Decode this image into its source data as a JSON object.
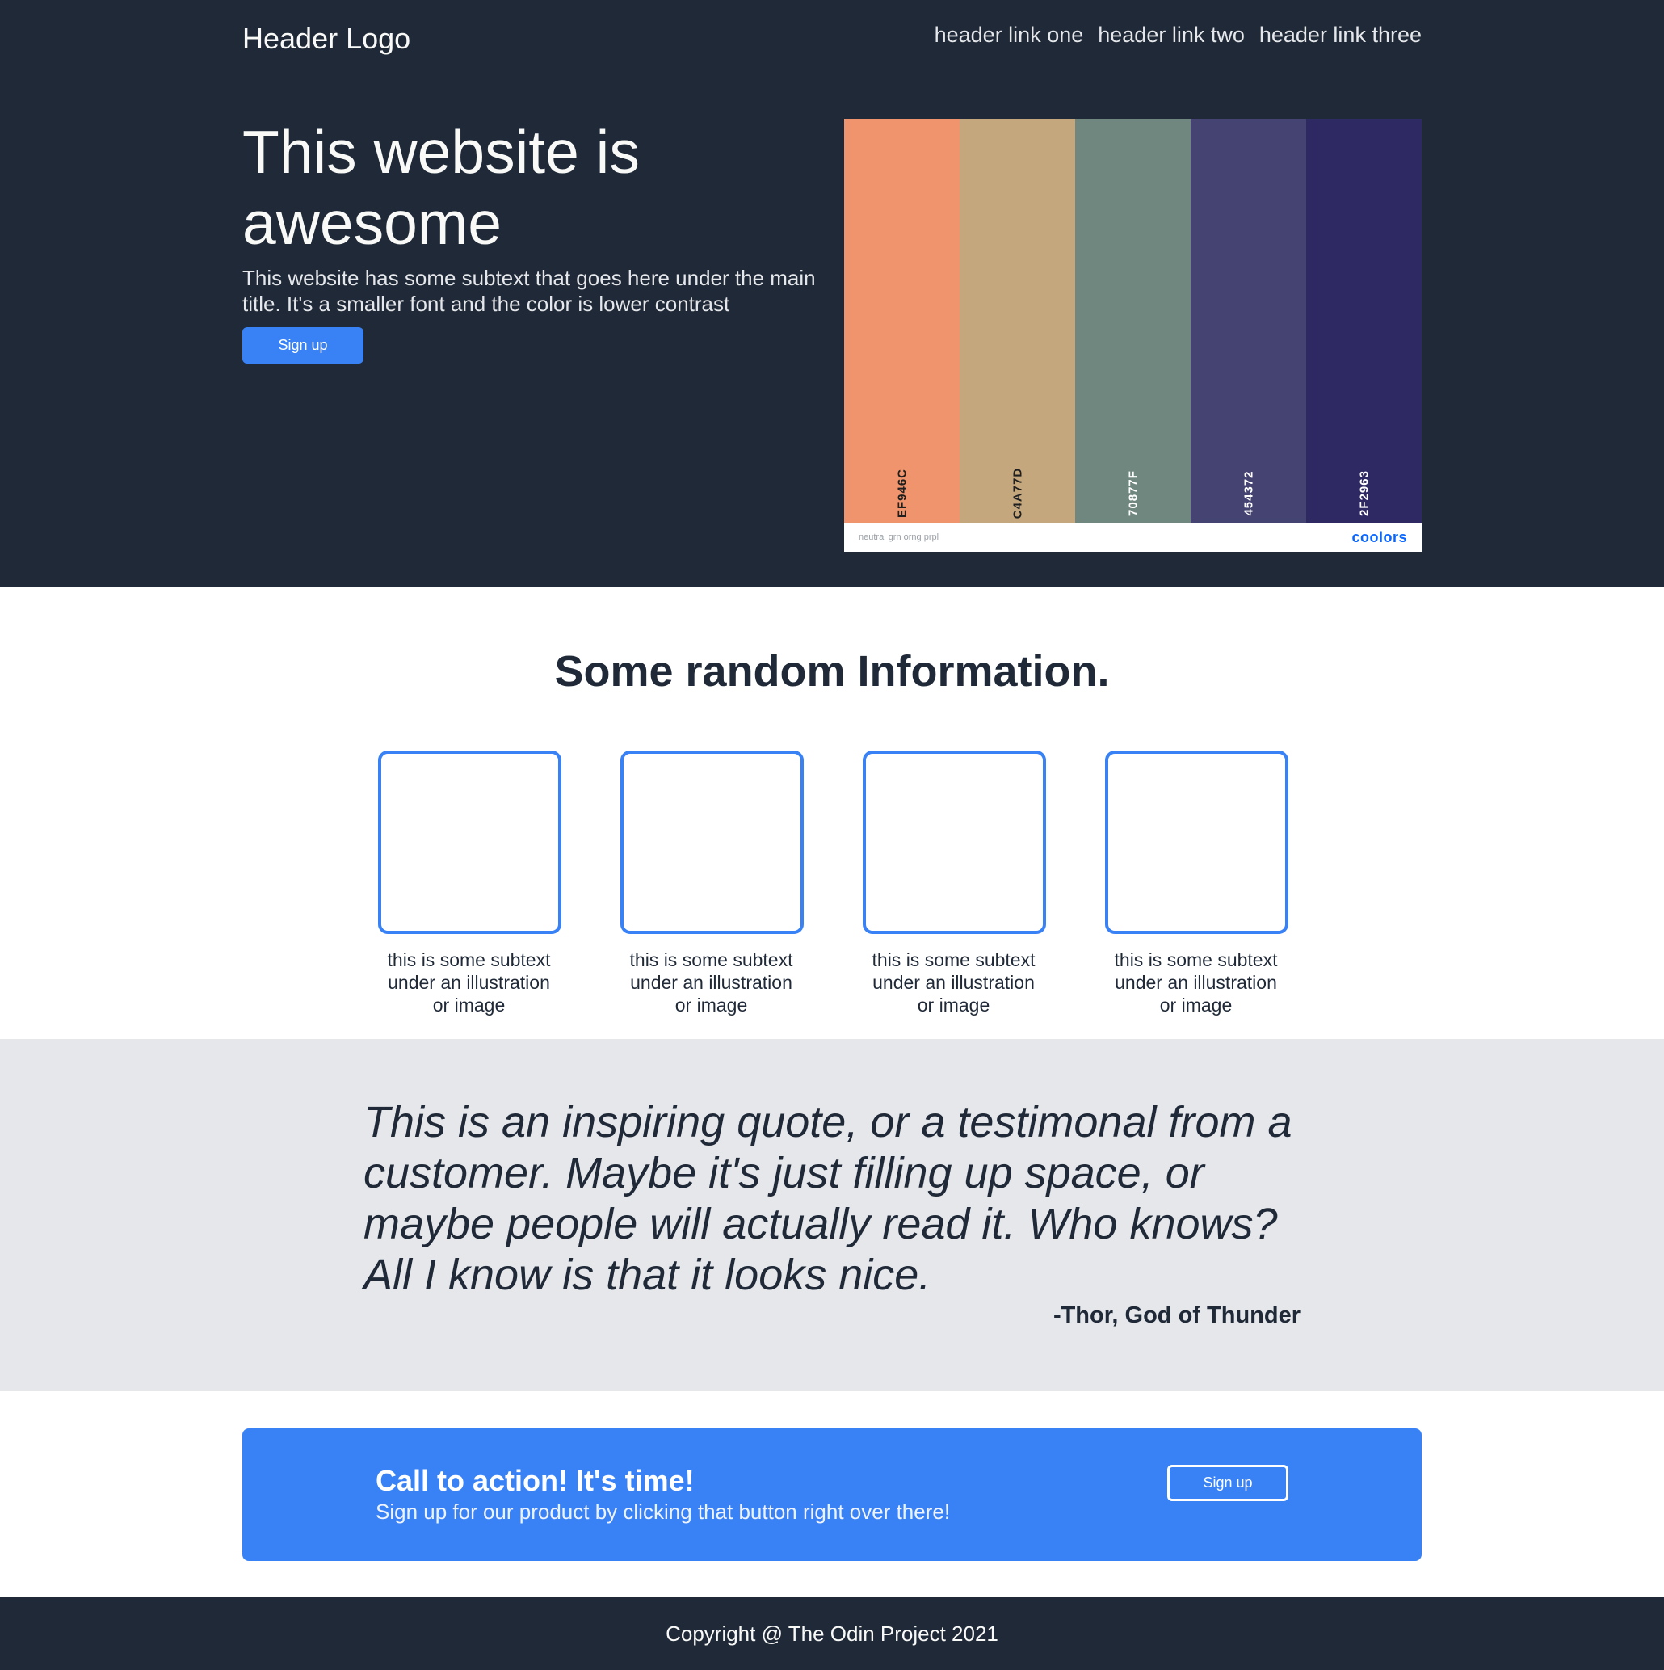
{
  "header": {
    "logo": "Header Logo",
    "links": [
      "header link one",
      "header link two",
      "header link three"
    ]
  },
  "hero": {
    "title": "This website is awesome",
    "subtext": "This website has some subtext that goes here under the main title. It's a smaller font and the color is lower contrast",
    "button_label": "Sign up"
  },
  "palette": {
    "swatches": [
      {
        "code": "EF946C",
        "color": "#EF946C",
        "text_color": "#1f1f1f"
      },
      {
        "code": "C4A77D",
        "color": "#C4A77D",
        "text_color": "#1f1f1f"
      },
      {
        "code": "70877F",
        "color": "#70877F",
        "text_color": "#ffffff"
      },
      {
        "code": "454372",
        "color": "#454372",
        "text_color": "#ffffff"
      },
      {
        "code": "2F2963",
        "color": "#2F2963",
        "text_color": "#ffffff"
      }
    ],
    "name": "neutral grn orng prpl",
    "brand": "coolors"
  },
  "info": {
    "title": "Some random Information.",
    "cards": [
      {
        "text": "this is some subtext under an illustration or image"
      },
      {
        "text": "this is some subtext under an illustration or image"
      },
      {
        "text": "this is some subtext under an illustration or image"
      },
      {
        "text": "this is some subtext under an illustration or image"
      }
    ]
  },
  "quote": {
    "text": "This is an inspiring quote, or a testimonal from a customer. Maybe it's just filling up space, or maybe people will actually read it. Who knows? All I know is that it looks nice.",
    "author": "-Thor, God of Thunder"
  },
  "cta": {
    "title": "Call to action! It's time!",
    "subtext": "Sign up for our product by clicking that button right over there!",
    "button_label": "Sign up"
  },
  "footer": {
    "copyright": "Copyright @ The Odin Project 2021"
  },
  "colors": {
    "dark": "#1f2937",
    "accent": "#3882f6",
    "light_gray": "#e5e7eb"
  }
}
